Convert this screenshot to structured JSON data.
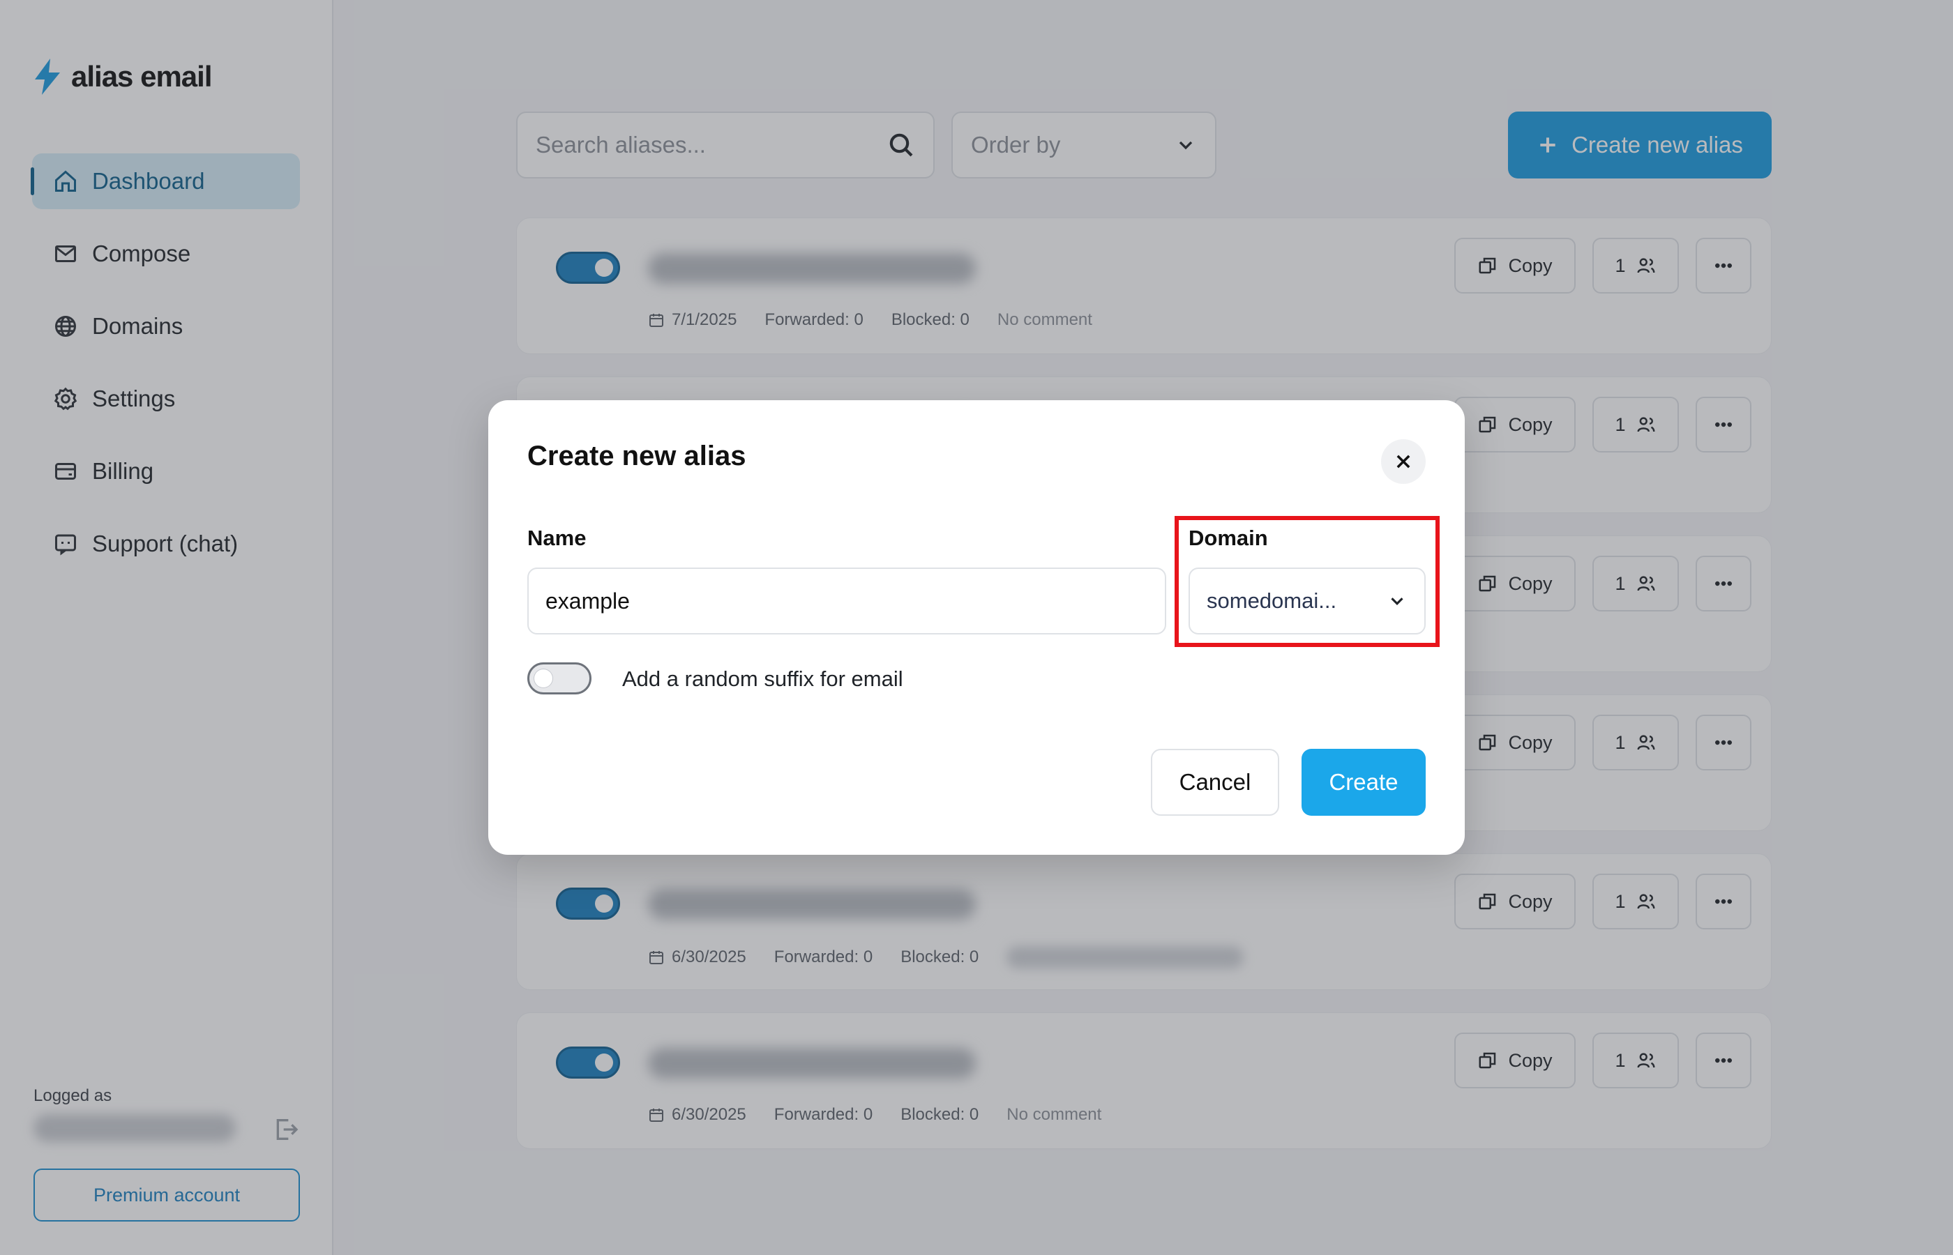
{
  "brand": {
    "name": "alias email",
    "accent": "#1a9be0"
  },
  "sidebar": {
    "items": [
      {
        "label": "Dashboard",
        "icon": "home-icon",
        "active": true
      },
      {
        "label": "Compose",
        "icon": "mail-icon"
      },
      {
        "label": "Domains",
        "icon": "globe-icon"
      },
      {
        "label": "Settings",
        "icon": "gear-icon"
      },
      {
        "label": "Billing",
        "icon": "wallet-icon"
      },
      {
        "label": "Support (chat)",
        "icon": "chat-icon"
      }
    ],
    "logged_label": "Logged as",
    "premium_label": "Premium account"
  },
  "toolbar": {
    "search_placeholder": "Search aliases...",
    "order_placeholder": "Order by",
    "create_label": "Create new alias"
  },
  "cards": [
    {
      "date": "7/1/2025",
      "forwarded": "Forwarded: 0",
      "blocked": "Blocked: 0",
      "comment": "No comment",
      "copy": "Copy",
      "count": "1"
    },
    {
      "date": "",
      "forwarded": "",
      "blocked": "",
      "comment": "",
      "copy": "Copy",
      "count": "1"
    },
    {
      "date": "",
      "forwarded": "",
      "blocked": "",
      "comment": "",
      "copy": "Copy",
      "count": "1"
    },
    {
      "date": "",
      "forwarded": "",
      "blocked": "",
      "comment": "",
      "copy": "Copy",
      "count": "1"
    },
    {
      "date": "6/30/2025",
      "forwarded": "Forwarded: 0",
      "blocked": "Blocked: 0",
      "comment": "",
      "copy": "Copy",
      "count": "1"
    },
    {
      "date": "6/30/2025",
      "forwarded": "Forwarded: 0",
      "blocked": "Blocked: 0",
      "comment": "No comment",
      "copy": "Copy",
      "count": "1"
    }
  ],
  "modal": {
    "title": "Create new alias",
    "name_label": "Name",
    "name_value": "example",
    "domain_label": "Domain",
    "domain_value": "somedomai...",
    "suffix_label": "Add a random suffix for email",
    "suffix_enabled": false,
    "cancel_label": "Cancel",
    "create_label": "Create",
    "highlight_color": "#e8141b"
  }
}
